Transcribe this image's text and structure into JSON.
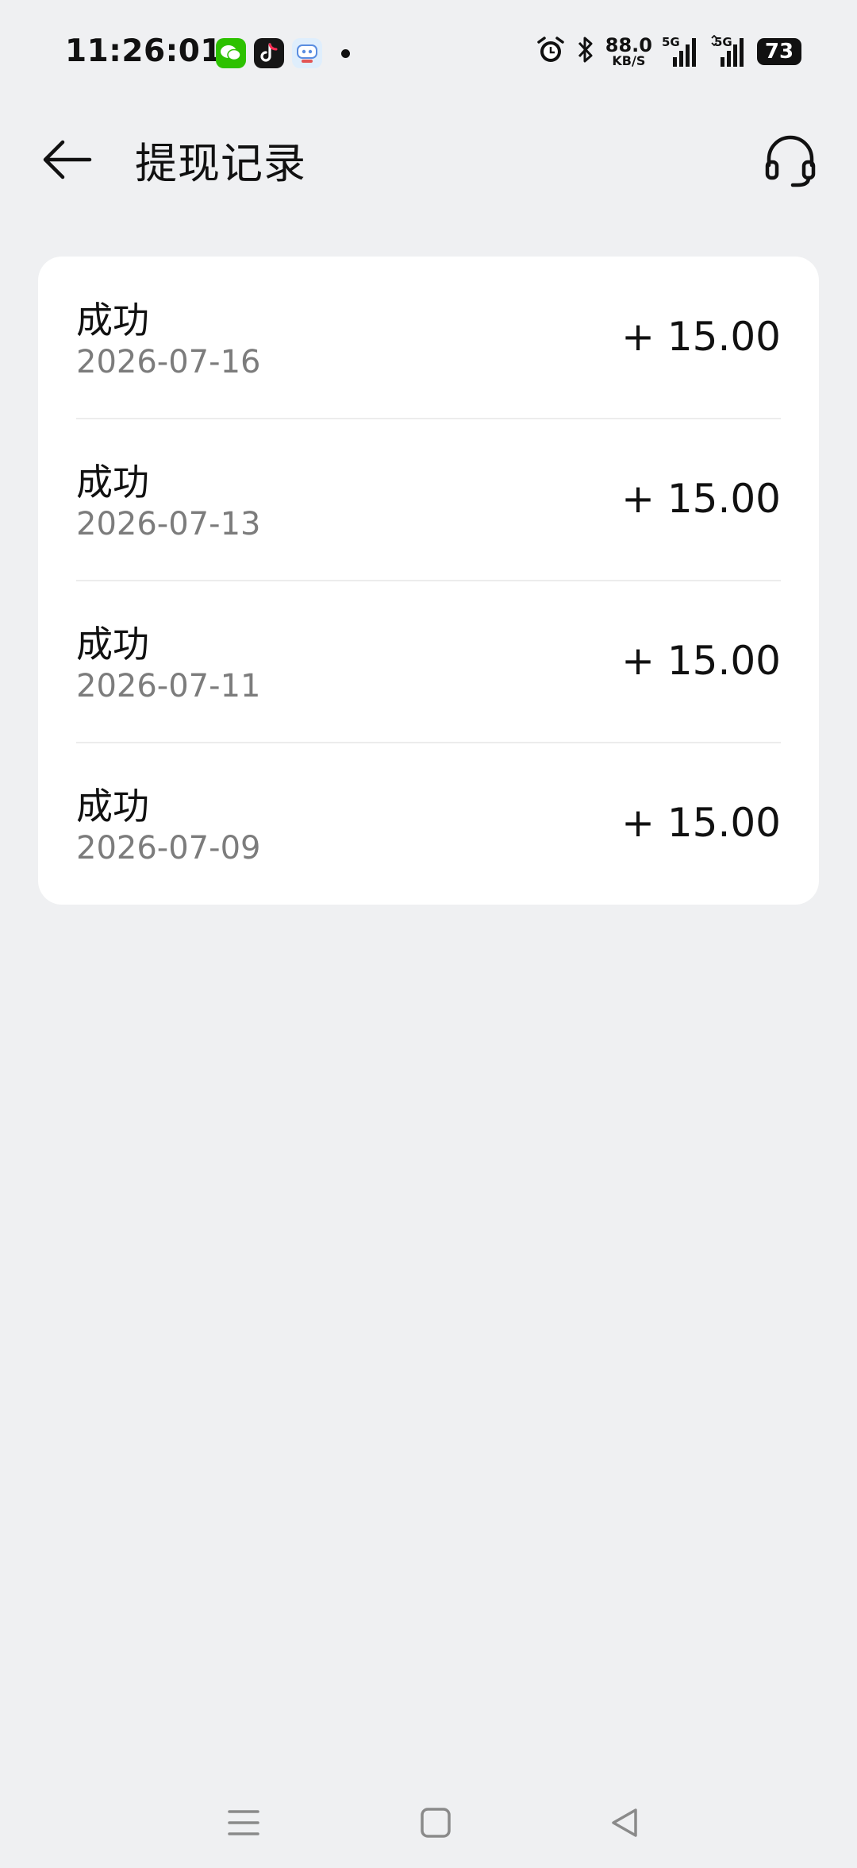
{
  "status_bar": {
    "time": "11:26:01",
    "net_speed_value": "88.0",
    "net_speed_unit": "KB/S",
    "signal1_label": "5G",
    "signal2_label": "5G",
    "battery": "73"
  },
  "header": {
    "title": "提现记录"
  },
  "records": [
    {
      "status": "成功",
      "date": "2026-07-16",
      "amount": "+ 15.00"
    },
    {
      "status": "成功",
      "date": "2026-07-13",
      "amount": "+ 15.00"
    },
    {
      "status": "成功",
      "date": "2026-07-11",
      "amount": "+ 15.00"
    },
    {
      "status": "成功",
      "date": "2026-07-09",
      "amount": "+ 15.00"
    }
  ]
}
